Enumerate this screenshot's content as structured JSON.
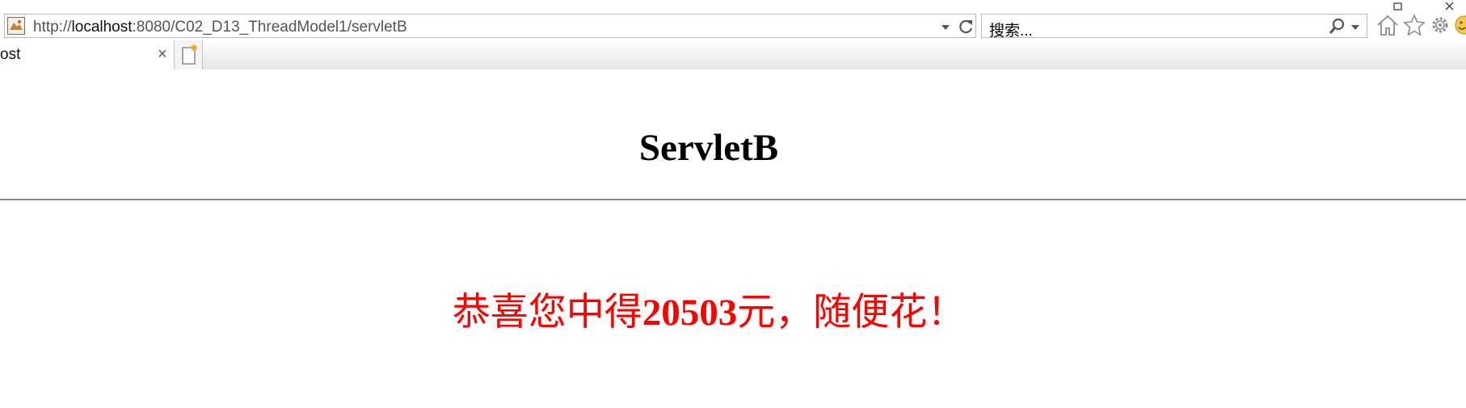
{
  "browser": {
    "address": {
      "scheme": "http://",
      "host": "localhost",
      "rest": ":8080/C02_D13_ThreadModel1/servletB"
    },
    "search": {
      "placeholder": "搜索..."
    },
    "tab": {
      "title": "ost",
      "close": "×"
    },
    "toolbar_icons": [
      "home-icon",
      "favorites-star-icon",
      "settings-gear-icon",
      "feedback-smiley-icon"
    ]
  },
  "page": {
    "heading": "ServletB",
    "message": {
      "prefix": "恭喜您中得",
      "amount": "20503",
      "suffix": "元，随便花！"
    },
    "message_color": "#ff0000"
  }
}
